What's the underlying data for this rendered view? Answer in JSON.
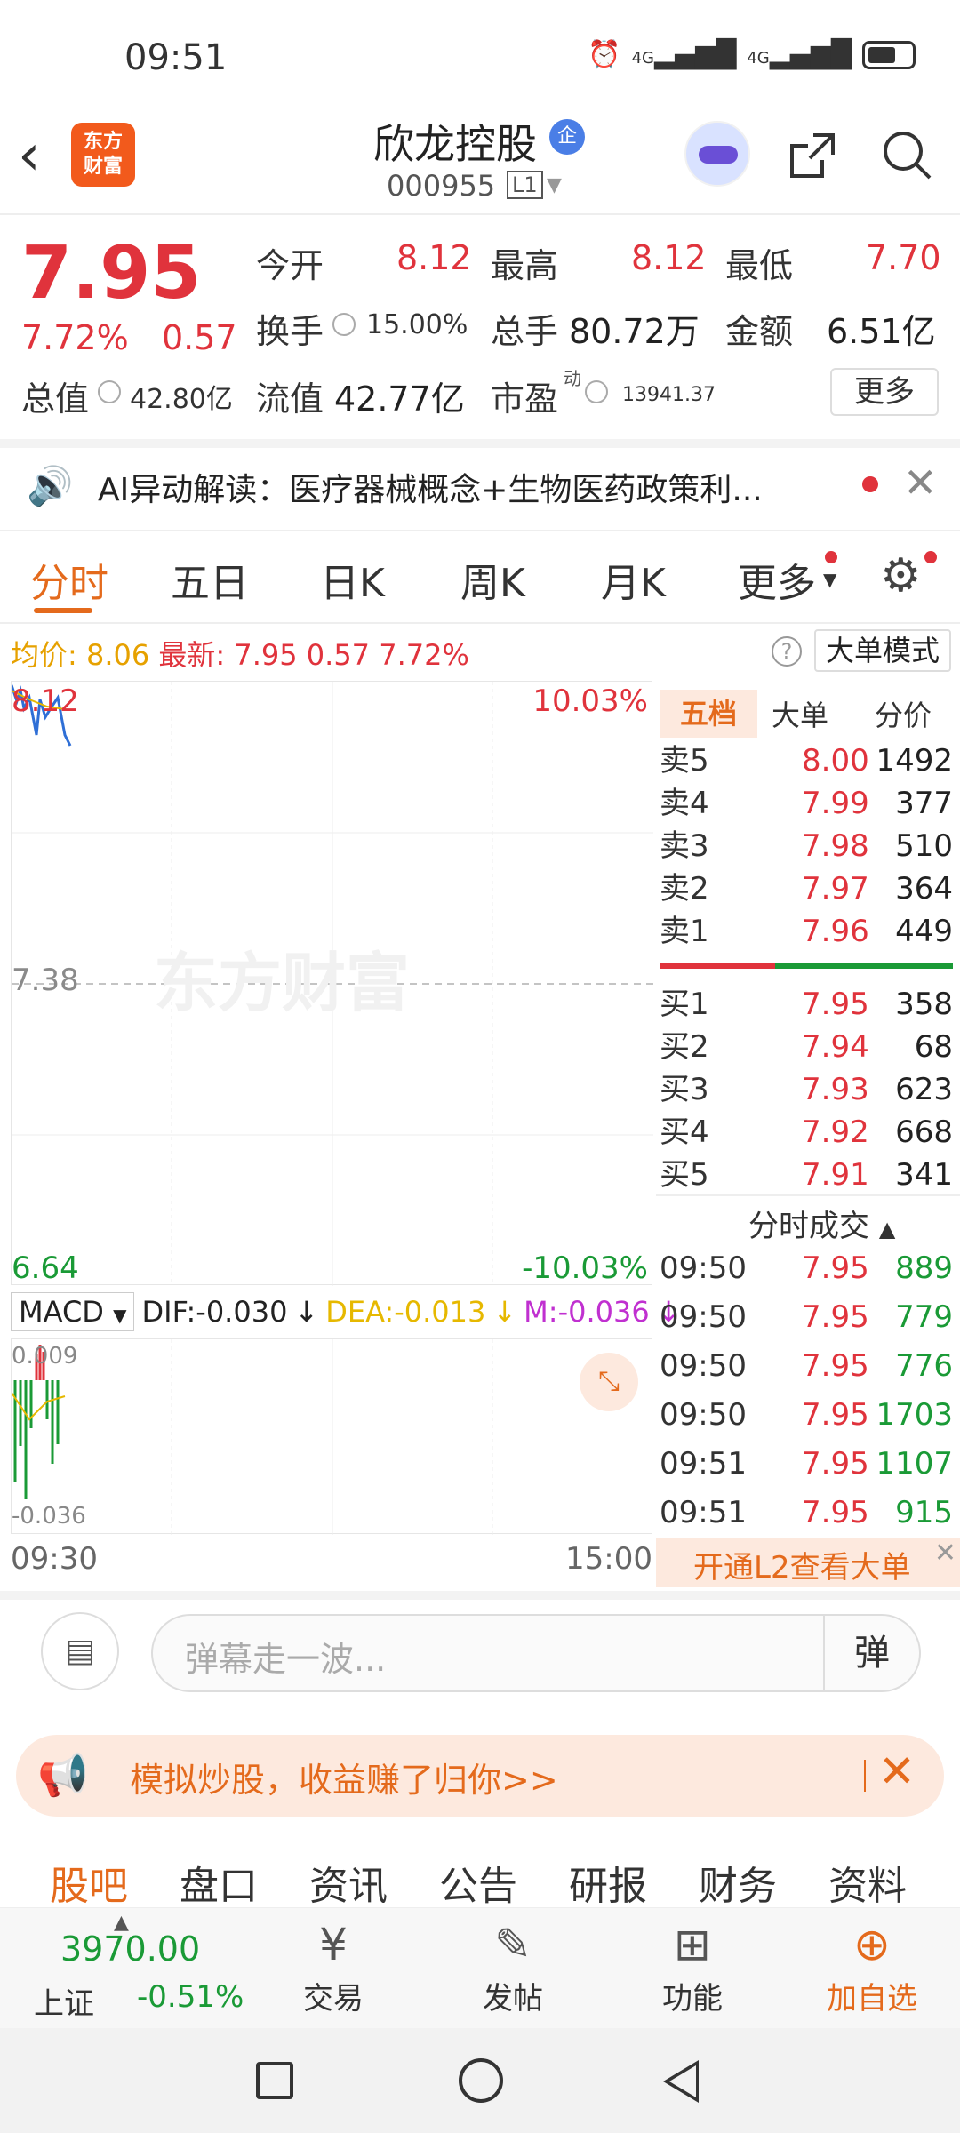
{
  "status": {
    "time": "09:51",
    "signal1": "4G",
    "signal2": "4G"
  },
  "header": {
    "back": "‹",
    "logo_line1": "东方",
    "logo_line2": "财富",
    "name": "欣龙控股",
    "qi_badge": "企",
    "code": "000955",
    "level": "L1"
  },
  "quote": {
    "price": "7.95",
    "pct": "7.72%",
    "change": "0.57",
    "open_label": "今开",
    "open": "8.12",
    "high_label": "最高",
    "high": "8.12",
    "low_label": "最低",
    "low": "7.70",
    "turnover_label": "换手",
    "turnover": "15.00%",
    "volume_label": "总手",
    "volume": "80.72万",
    "amount_label": "金额",
    "amount": "6.51亿",
    "mktcap_label": "总值",
    "mktcap": "42.80亿",
    "float_label": "流值",
    "float": "42.77亿",
    "pe_label": "市盈",
    "pe_sup": "动",
    "pe": "13941.37",
    "more": "更多"
  },
  "ai": {
    "text": "AI异动解读：医疗器械概念+生物医药政策利..."
  },
  "tabs": [
    "分时",
    "五日",
    "日K",
    "周K",
    "月K",
    "更多"
  ],
  "avg": {
    "avg_label": "均价:",
    "avg": "8.06",
    "latest_label": "最新:",
    "latest": "7.95",
    "chg": "0.57",
    "pct": "7.72%",
    "help": "?",
    "mode": "大单模式"
  },
  "chart": {
    "top_price": "8.12",
    "top_pct": "10.03%",
    "mid_price": "7.38",
    "bottom_price": "6.64",
    "bottom_pct": "-10.03%",
    "watermark": "东方财富",
    "t_start": "09:30",
    "t_end": "15:00"
  },
  "macd": {
    "name": "MACD",
    "dif": "DIF:-0.030",
    "dea": "DEA:-0.013",
    "m": "M:-0.036",
    "top": "0.009",
    "bottom": "-0.036",
    "arrow": "↓",
    "dif_color": "#222222",
    "dea_color": "#e6b800",
    "m_color": "#c030d0"
  },
  "orderbook": {
    "tabs": [
      "五档",
      "大单",
      "分价"
    ],
    "asks": [
      {
        "k": "卖5",
        "p": "8.00",
        "v": "1492"
      },
      {
        "k": "卖4",
        "p": "7.99",
        "v": "377"
      },
      {
        "k": "卖3",
        "p": "7.98",
        "v": "510"
      },
      {
        "k": "卖2",
        "p": "7.97",
        "v": "364"
      },
      {
        "k": "卖1",
        "p": "7.96",
        "v": "449"
      }
    ],
    "bids": [
      {
        "k": "买1",
        "p": "7.95",
        "v": "358"
      },
      {
        "k": "买2",
        "p": "7.94",
        "v": "68"
      },
      {
        "k": "买3",
        "p": "7.93",
        "v": "623"
      },
      {
        "k": "买4",
        "p": "7.92",
        "v": "668"
      },
      {
        "k": "买5",
        "p": "7.91",
        "v": "341"
      }
    ]
  },
  "trades": {
    "title": "分时成交",
    "rows": [
      {
        "t": "09:50",
        "p": "7.95",
        "v": "889"
      },
      {
        "t": "09:50",
        "p": "7.95",
        "v": "779"
      },
      {
        "t": "09:50",
        "p": "7.95",
        "v": "776"
      },
      {
        "t": "09:50",
        "p": "7.95",
        "v": "1703"
      },
      {
        "t": "09:51",
        "p": "7.95",
        "v": "1107"
      },
      {
        "t": "09:51",
        "p": "7.95",
        "v": "915"
      }
    ],
    "l2": "开通L2查看大单"
  },
  "comment": {
    "placeholder": "弹幕走一波...",
    "btn": "弹"
  },
  "promo": {
    "text": "模拟炒股，收益赚了归你>>"
  },
  "subtabs": [
    "股吧",
    "盘口",
    "资讯",
    "公告",
    "研报",
    "财务",
    "资料"
  ],
  "bottom": {
    "index_value": "3970.00",
    "index_name": "上证",
    "index_pct": "-0.51%",
    "items": [
      {
        "label": "交易",
        "icon": "yen-icon"
      },
      {
        "label": "发帖",
        "icon": "edit-icon"
      },
      {
        "label": "功能",
        "icon": "grid-icon"
      },
      {
        "label": "加自选",
        "icon": "plus-circle-icon"
      }
    ]
  },
  "colors": {
    "up": "#e0333c",
    "down": "#1a9a36",
    "accent": "#e46a1c"
  }
}
